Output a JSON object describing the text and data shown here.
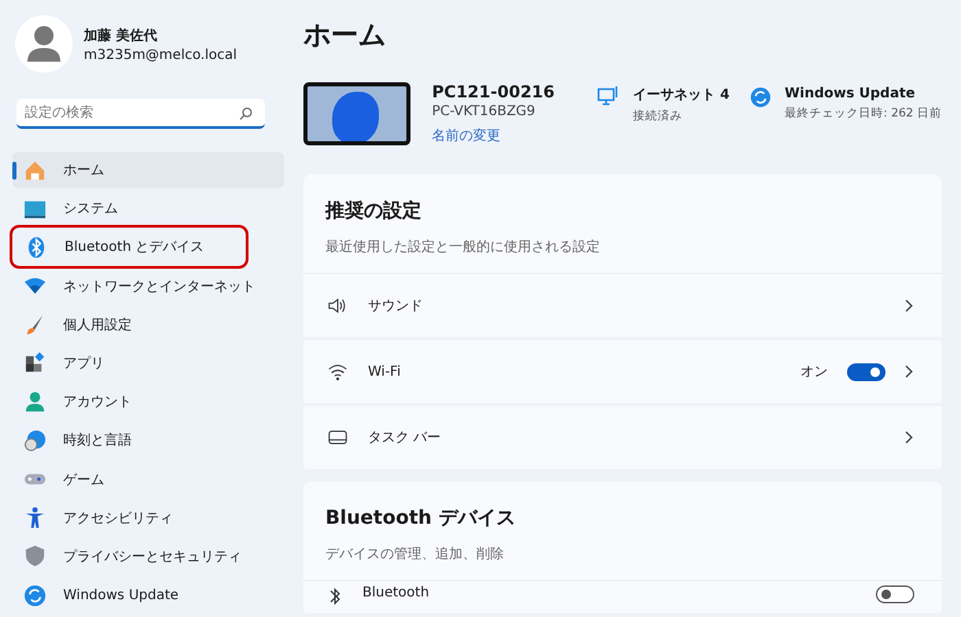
{
  "user": {
    "name": "加藤 美佐代",
    "email": "m3235m@melco.local"
  },
  "search": {
    "placeholder": "設定の検索"
  },
  "sidebar": {
    "items": [
      {
        "label": "ホーム",
        "selected": true,
        "highlighted": false
      },
      {
        "label": "システム",
        "selected": false,
        "highlighted": false
      },
      {
        "label": "Bluetooth とデバイス",
        "selected": false,
        "highlighted": true
      },
      {
        "label": "ネットワークとインターネット",
        "selected": false,
        "highlighted": false
      },
      {
        "label": "個人用設定",
        "selected": false,
        "highlighted": false
      },
      {
        "label": "アプリ",
        "selected": false,
        "highlighted": false
      },
      {
        "label": "アカウント",
        "selected": false,
        "highlighted": false
      },
      {
        "label": "時刻と言語",
        "selected": false,
        "highlighted": false
      },
      {
        "label": "ゲーム",
        "selected": false,
        "highlighted": false
      },
      {
        "label": "アクセシビリティ",
        "selected": false,
        "highlighted": false
      },
      {
        "label": "プライバシーとセキュリティ",
        "selected": false,
        "highlighted": false
      },
      {
        "label": "Windows Update",
        "selected": false,
        "highlighted": false
      }
    ]
  },
  "page_title": "ホーム",
  "device": {
    "name": "PC121-00216",
    "model": "PC-VKT16BZG9",
    "rename_link": "名前の変更"
  },
  "status": [
    {
      "title": "イーサネット 4",
      "detail": "接続済み"
    },
    {
      "title": "Windows Update",
      "detail": "最終チェック日時: 262 日前"
    }
  ],
  "recommended": {
    "title": "推奨の設定",
    "subtitle": "最近使用した設定と一般的に使用される設定",
    "rows": [
      {
        "kind": "link",
        "label": "サウンド"
      },
      {
        "kind": "toggle",
        "label": "Wi-Fi",
        "state_label": "オン",
        "on": true
      },
      {
        "kind": "link",
        "label": "タスク バー"
      }
    ]
  },
  "bluetooth": {
    "title": "Bluetooth デバイス",
    "subtitle": "デバイスの管理、追加、削除",
    "rows": [
      {
        "kind": "toggle",
        "label": "Bluetooth",
        "on": false
      }
    ]
  }
}
